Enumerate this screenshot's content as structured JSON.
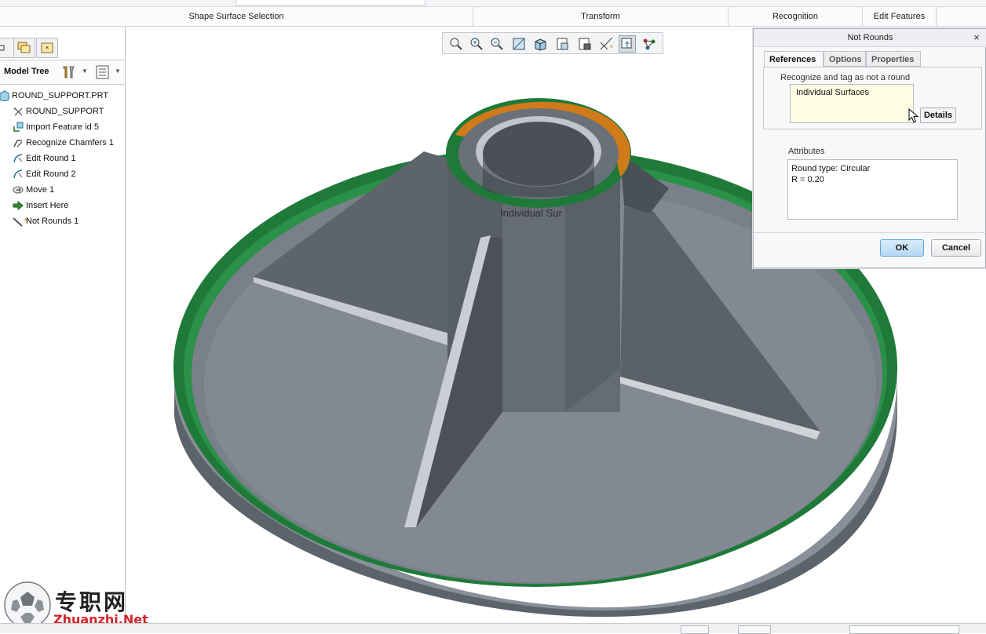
{
  "ribbon": {
    "groups": [
      "Shape Surface Selection",
      "Transform",
      "Recognition",
      "Edit Features"
    ]
  },
  "model_tree": {
    "title": "Model Tree",
    "items": [
      {
        "label": "ROUND_SUPPORT.PRT",
        "icon": "part-icon"
      },
      {
        "label": "ROUND_SUPPORT",
        "icon": "coordinate-system-icon"
      },
      {
        "label": "Import Feature id 5",
        "icon": "import-feature-icon"
      },
      {
        "label": "Recognize Chamfers 1",
        "icon": "recognize-chamfer-icon"
      },
      {
        "label": "Edit Round 1",
        "icon": "edit-round-icon"
      },
      {
        "label": "Edit Round 2",
        "icon": "edit-round-icon"
      },
      {
        "label": "Move 1",
        "icon": "move-icon"
      },
      {
        "label": "Insert Here",
        "icon": "insert-arrow-icon"
      },
      {
        "label": "Not Rounds 1",
        "icon": "not-round-icon"
      }
    ]
  },
  "viewport": {
    "surface_label": "Individual Sur"
  },
  "dialog": {
    "title": "Not Rounds",
    "close": "×",
    "tabs": [
      "References",
      "Options",
      "Properties"
    ],
    "active_tab": "References",
    "references_label": "Recognize and tag as not a round",
    "references_value": "Individual Surfaces",
    "details_button": "Details",
    "attributes_label": "Attributes",
    "attributes_lines": [
      "Round type: Circular",
      "R = 0.20"
    ],
    "ok_button": "OK",
    "cancel_button": "Cancel"
  },
  "watermark": {
    "chinese": "专职网",
    "url": "Zhuanzhi.Net"
  },
  "colors": {
    "round_green": "#1f7a3a",
    "round_orange": "#d07a1a",
    "model_gray": "#7a8089",
    "ok_blue": "#b6d9f4"
  }
}
